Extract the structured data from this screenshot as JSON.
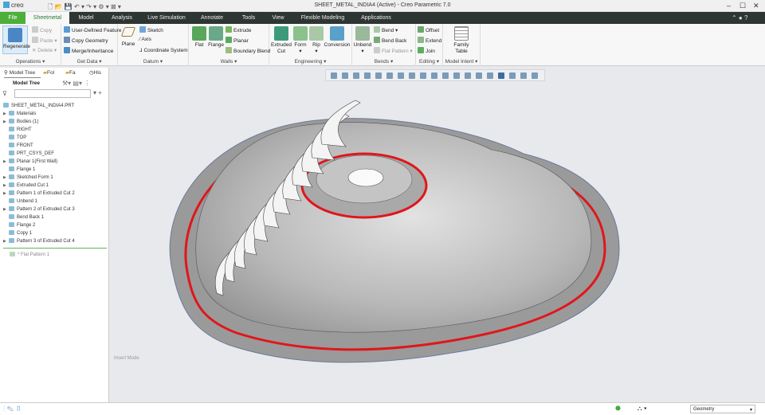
{
  "window": {
    "title": "SHEET_METAL_INDIA4 (Active) - Creo Parametric 7.0",
    "logo": "creo"
  },
  "tabs": [
    "File",
    "Sheetmetal",
    "Model",
    "Analysis",
    "Live Simulation",
    "Annotate",
    "Tools",
    "View",
    "Flexible Modeling",
    "Applications"
  ],
  "ribbon": {
    "operations": {
      "label": "Operations",
      "regenerate": "Regenerate",
      "copy": "Copy",
      "paste": "Paste",
      "delete": "Delete"
    },
    "get_data": {
      "label": "Get Data",
      "udf": "User-Defined Feature",
      "copy_geometry": "Copy Geometry",
      "merge": "Merge/Inheritance"
    },
    "datum": {
      "label": "Datum",
      "plane": "Plane",
      "sketch": "Sketch",
      "axis": "Axis",
      "csys": "Coordinate System"
    },
    "walls": {
      "label": "Walls",
      "flat": "Flat",
      "flange": "Flange",
      "extrude": "Extrude",
      "planar": "Planar",
      "boundary_blend": "Boundary Blend"
    },
    "engineering": {
      "label": "Engineering",
      "extruded_cut": "Extruded Cut",
      "form": "Form",
      "rip": "Rip",
      "conversion": "Conversion"
    },
    "bends": {
      "label": "Bends",
      "unbend": "Unbend",
      "bend": "Bend",
      "bend_back": "Bend Back",
      "flat_pattern": "Flat Pattern"
    },
    "editing": {
      "label": "Editing",
      "offset": "Offset",
      "extend": "Extend",
      "join": "Join"
    },
    "model_intent": {
      "label": "Model Intent",
      "family_table": "Family Table"
    }
  },
  "left_panel": {
    "tabs": [
      "Model Tree",
      "Fol",
      "Fa",
      "His"
    ],
    "header": "Model Tree",
    "search_placeholder": "",
    "root": "SHEET_METAL_INDIA4.PRT",
    "items": [
      {
        "label": "Materials",
        "expand": true
      },
      {
        "label": "Bodies (1)",
        "expand": true
      },
      {
        "label": "RIGHT",
        "expand": false
      },
      {
        "label": "TOP",
        "expand": false
      },
      {
        "label": "FRONT",
        "expand": false
      },
      {
        "label": "PRT_CSYS_DEF",
        "expand": false
      },
      {
        "label": "Planar 1(First Wall)",
        "expand": true
      },
      {
        "label": "Flange 1",
        "expand": false
      },
      {
        "label": "Sketched Form 1",
        "expand": true
      },
      {
        "label": "Extruded Cut 1",
        "expand": true
      },
      {
        "label": "Pattern 1 of Extruded Cut 2",
        "expand": true
      },
      {
        "label": "Unbend 1",
        "expand": false
      },
      {
        "label": "Pattern 2 of Extruded Cut 3",
        "expand": true
      },
      {
        "label": "Bend Back 1",
        "expand": false
      },
      {
        "label": "Flange 2",
        "expand": false
      },
      {
        "label": "Copy 1",
        "expand": false
      },
      {
        "label": "Pattern 3 of Extruded Cut 4",
        "expand": true
      }
    ],
    "insert_item": "Flat Pattern 1"
  },
  "graphics": {
    "mode_text": "Insert Mode"
  },
  "status": {
    "filter": "Geometry"
  },
  "colors": {
    "file_tab": "#4caf3a",
    "tab_bar": "#2e3633",
    "accent_red": "#e0161b",
    "part": "#b9b9b9",
    "background": "#e7e9ed"
  }
}
